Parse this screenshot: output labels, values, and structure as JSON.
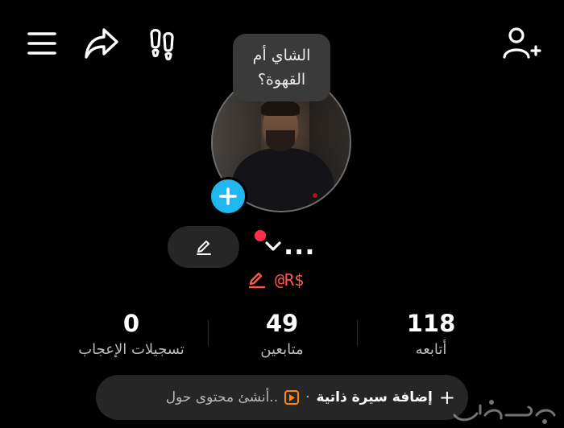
{
  "bubble": {
    "line1": "الشاي أم",
    "line2": "القهوة؟"
  },
  "profile": {
    "name": "...",
    "handle": "@R$"
  },
  "stats": {
    "following": {
      "value": "118",
      "label": "أتابعه"
    },
    "followers": {
      "value": "49",
      "label": "متابعين"
    },
    "likes": {
      "value": "0",
      "label": "تسجيلات الإعجاب"
    }
  },
  "bottom_bar": {
    "add_bio": "إضافة سيرة ذاتية",
    "separator": "·",
    "create_hint": "أنشئ محتوى حول..",
    "plus": "+"
  },
  "icons": {
    "menu": "menu-icon",
    "share": "share-icon",
    "footprints": "footprints-icon",
    "add_user": "add-user-icon",
    "edit": "pencil-icon",
    "add_avatar": "plus-icon",
    "chevron": "chevron-down-icon",
    "handle_edit": "pencil-icon",
    "play": "play-icon"
  },
  "colors": {
    "background": "#000000",
    "accent_blue": "#21b7ee",
    "handle_red": "#ff5a45",
    "notification_red": "#ff2e4d",
    "pill": "#262626"
  }
}
